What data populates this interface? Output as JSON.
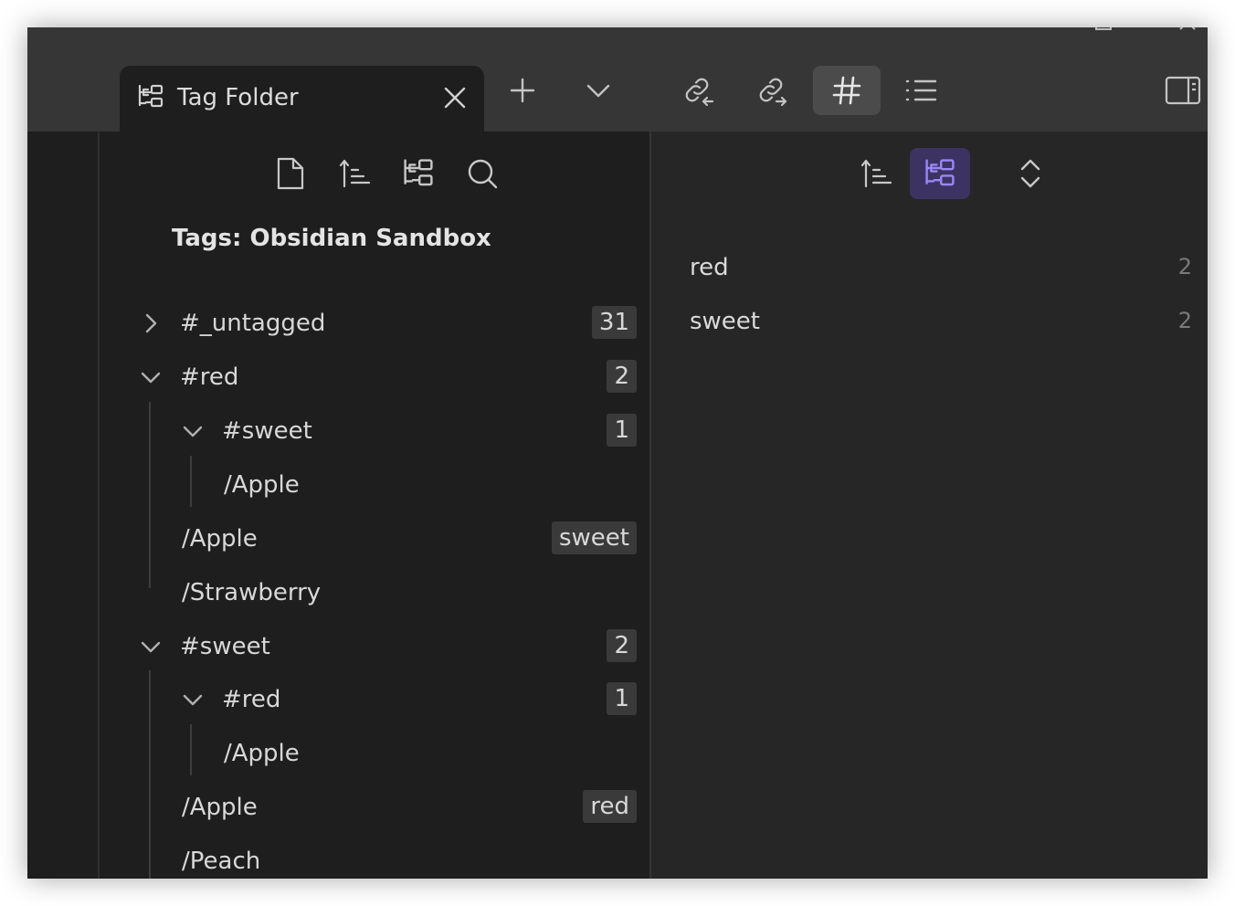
{
  "tab": {
    "title": "Tag Folder"
  },
  "toolbar": {
    "icons": [
      "new-tab-icon",
      "tab-list-chevron-icon",
      "backlinks-icon",
      "outgoing-links-icon",
      "tags-icon",
      "outline-icon",
      "right-sidebar-toggle-icon"
    ],
    "active": "tags-icon"
  },
  "left": {
    "heading": "Tags: Obsidian Sandbox",
    "nav_icons": [
      "new-note-icon",
      "sort-icon",
      "tag-folder-icon",
      "search-icon"
    ],
    "rows": [
      {
        "label": "#_untagged",
        "badge": "31",
        "state": "collapsed"
      },
      {
        "label": "#red",
        "badge": "2",
        "state": "expanded"
      },
      {
        "label": "#sweet",
        "badge": "1",
        "state": "expanded"
      },
      {
        "label": "/Apple",
        "badge": ""
      },
      {
        "label": "/Apple",
        "badge": "sweet"
      },
      {
        "label": "/Strawberry",
        "badge": ""
      },
      {
        "label": "#sweet",
        "badge": "2",
        "state": "expanded"
      },
      {
        "label": "#red",
        "badge": "1",
        "state": "expanded"
      },
      {
        "label": "/Apple",
        "badge": ""
      },
      {
        "label": "/Apple",
        "badge": "red"
      },
      {
        "label": "/Peach",
        "badge": ""
      }
    ]
  },
  "right": {
    "nav_icons": [
      "sort-icon",
      "tag-folder-icon",
      "expand-collapse-icon"
    ],
    "active": "tag-folder-icon",
    "tags": [
      {
        "name": "red",
        "count": "2"
      },
      {
        "name": "sweet",
        "count": "2"
      }
    ]
  },
  "colors": {
    "accent": "#9b87f5",
    "background": "#1e1e1e",
    "titlebar": "#363636"
  }
}
